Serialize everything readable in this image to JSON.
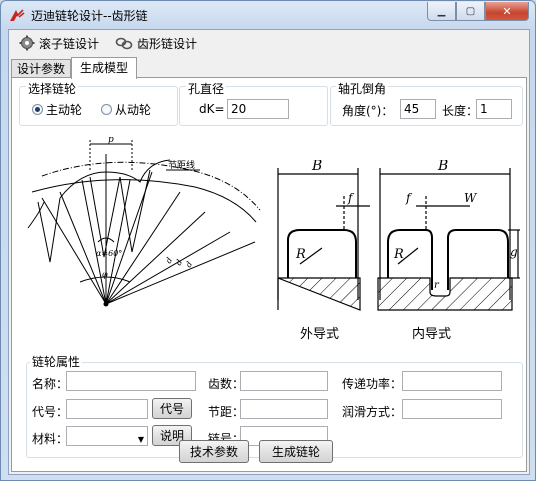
{
  "window": {
    "title": "迈迪链轮设计--齿形链"
  },
  "toolbar": {
    "roller_chain": "滚子链设计",
    "tooth_chain": "齿形链设计"
  },
  "tabs": [
    "设计参数",
    "生成模型"
  ],
  "sprocket_select": {
    "legend": "选择链轮",
    "options": [
      "主动轮",
      "从动轮"
    ],
    "selected": "主动轮"
  },
  "bore": {
    "legend": "孔直径",
    "label": "dK=",
    "value": "20"
  },
  "chamfer": {
    "legend": "轴孔倒角",
    "angle_label": "角度(°)：",
    "angle_value": "45",
    "length_label": "长度：",
    "length_value": "1"
  },
  "diagram": {
    "left": {
      "p": "p",
      "pitch_line": "节距线",
      "alpha": "α=60°",
      "phi": "φ",
      "d1": "d",
      "d2": "d",
      "d3": "d"
    },
    "right": {
      "B": "B",
      "f": "f",
      "W": "W",
      "R": "R",
      "g": "g",
      "r": "r",
      "outer": "外导式",
      "inner": "内导式"
    }
  },
  "attrs": {
    "legend": "链轮属性",
    "name_label": "名称：",
    "name_value": "",
    "teeth_label": "齿数：",
    "teeth_value": "",
    "power_label": "传递功率：",
    "power_value": "",
    "code_label": "代号：",
    "code_value": "",
    "code_button": "代号",
    "pitch_label": "节距：",
    "pitch_value": "",
    "lube_label": "润滑方式：",
    "lube_value": "",
    "material_label": "材料：",
    "material_value": "",
    "explain_button": "说明",
    "chainno_label": "链号：",
    "chainno_value": ""
  },
  "buttons": {
    "tech": "技术参数",
    "generate": "生成链轮"
  }
}
